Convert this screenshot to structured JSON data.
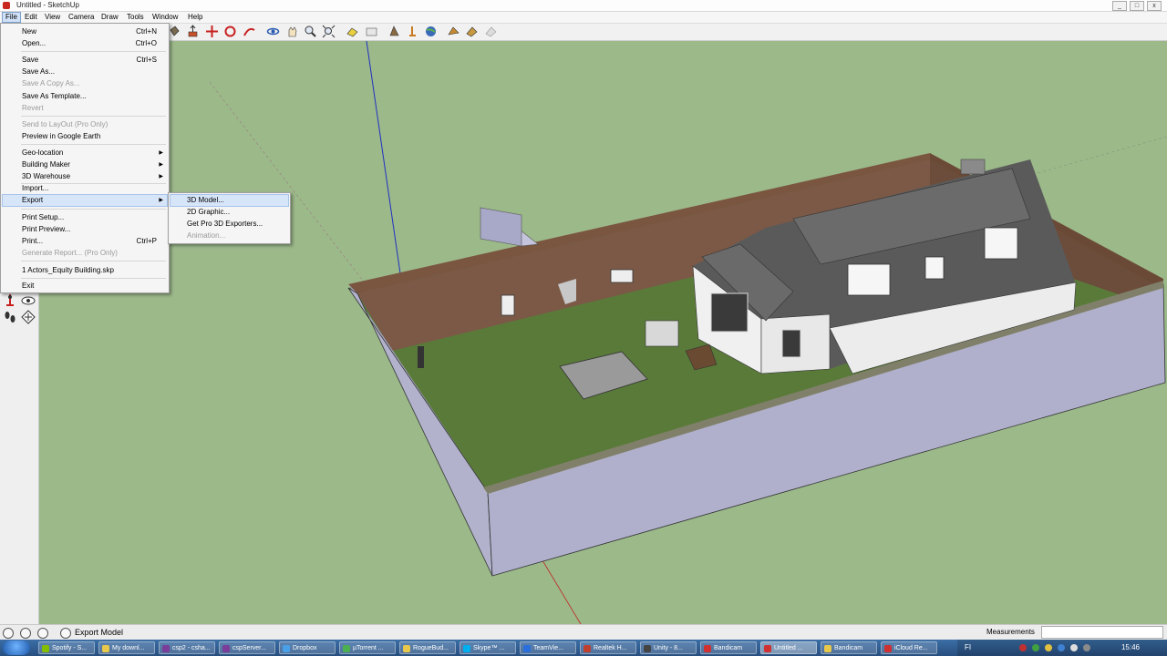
{
  "window": {
    "title": "Untitled - SketchUp",
    "controls": [
      "_",
      "□",
      "x"
    ]
  },
  "menubar": [
    "File",
    "Edit",
    "View",
    "Camera",
    "Draw",
    "Tools",
    "Window",
    "Help"
  ],
  "file_menu": {
    "items": [
      {
        "label": "New",
        "shortcut": "Ctrl+N"
      },
      {
        "label": "Open...",
        "shortcut": "Ctrl+O"
      },
      {
        "label": "Save",
        "shortcut": "Ctrl+S"
      },
      {
        "label": "Save As..."
      },
      {
        "label": "Save A Copy As...",
        "disabled": true
      },
      {
        "label": "Save As Template..."
      },
      {
        "label": "Revert",
        "disabled": true
      },
      {
        "label": "Send to LayOut (Pro Only)",
        "disabled": true
      },
      {
        "label": "Preview in Google Earth"
      },
      {
        "label": "Geo-location",
        "submenu": true
      },
      {
        "label": "Building Maker",
        "submenu": true
      },
      {
        "label": "3D Warehouse",
        "submenu": true
      },
      {
        "label": "Import..."
      },
      {
        "label": "Export",
        "submenu": true,
        "highlighted": true
      },
      {
        "label": "Print Setup..."
      },
      {
        "label": "Print Preview..."
      },
      {
        "label": "Print...",
        "shortcut": "Ctrl+P"
      },
      {
        "label": "Generate Report... (Pro Only)",
        "disabled": true
      },
      {
        "label": "1 Actors_Equity Building.skp"
      },
      {
        "label": "Exit"
      }
    ]
  },
  "export_submenu": {
    "items": [
      {
        "label": "3D Model...",
        "highlighted": true
      },
      {
        "label": "2D Graphic..."
      },
      {
        "label": "Get Pro 3D Exporters..."
      },
      {
        "label": "Animation...",
        "disabled": true
      }
    ]
  },
  "statusbar": {
    "text": "Export Model",
    "measurements_label": "Measurements",
    "measurements_value": ""
  },
  "taskbar": {
    "tasks": [
      {
        "label": "Spotify - S...",
        "color": "#84bd00"
      },
      {
        "label": "My downl...",
        "color": "#e8c84a"
      },
      {
        "label": "csp2 - csha...",
        "color": "#7a3d9a"
      },
      {
        "label": "cspServer...",
        "color": "#7a3d9a"
      },
      {
        "label": "Dropbox",
        "color": "#4aa0e8"
      },
      {
        "label": "µTorrent ...",
        "color": "#4caf50"
      },
      {
        "label": "RogueBud...",
        "color": "#e8c84a"
      },
      {
        "label": "Skype™ ...",
        "color": "#00aff0"
      },
      {
        "label": "TeamVie...",
        "color": "#2a6fdb"
      },
      {
        "label": "Realtek H...",
        "color": "#c04030"
      },
      {
        "label": "Unity - 8...",
        "color": "#444444"
      },
      {
        "label": "Bandicam",
        "color": "#d03030"
      },
      {
        "label": "Untitled ...",
        "color": "#d03030",
        "active": true
      },
      {
        "label": "Bandicam",
        "color": "#e8c84a"
      },
      {
        "label": "iCloud Re...",
        "color": "#d03030"
      }
    ],
    "tray_lang": "FI",
    "clock": "15:46"
  },
  "colors": {
    "sky": "#9cb98a",
    "grass": "#5a7a3a",
    "wall_side": "#aeaec8",
    "wall_top": "#7a5540",
    "menu_highlight": "#d7e5f9"
  }
}
